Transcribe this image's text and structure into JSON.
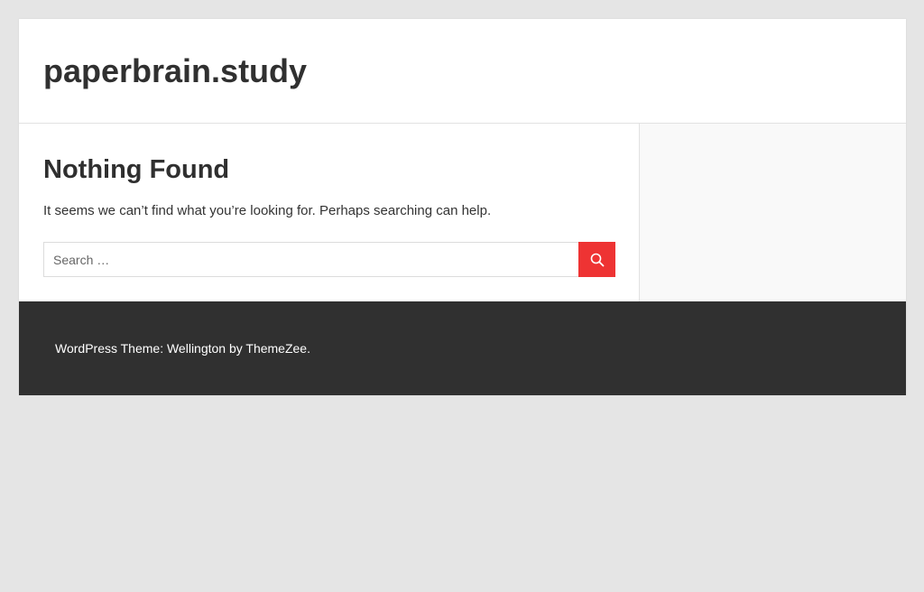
{
  "colors": {
    "background": "#e5e5e5",
    "accent": "#ee3333",
    "footer_background": "#303030",
    "sidebar_background": "#f9f9f9"
  },
  "header": {
    "site_title": "paperbrain.study"
  },
  "main": {
    "title": "Nothing Found",
    "message": "It seems we can’t find what you’re looking for. Perhaps searching can help.",
    "search": {
      "value": "",
      "placeholder": "Search …",
      "button_icon": "search-icon"
    }
  },
  "footer": {
    "credit": "WordPress Theme: Wellington by ThemeZee."
  }
}
